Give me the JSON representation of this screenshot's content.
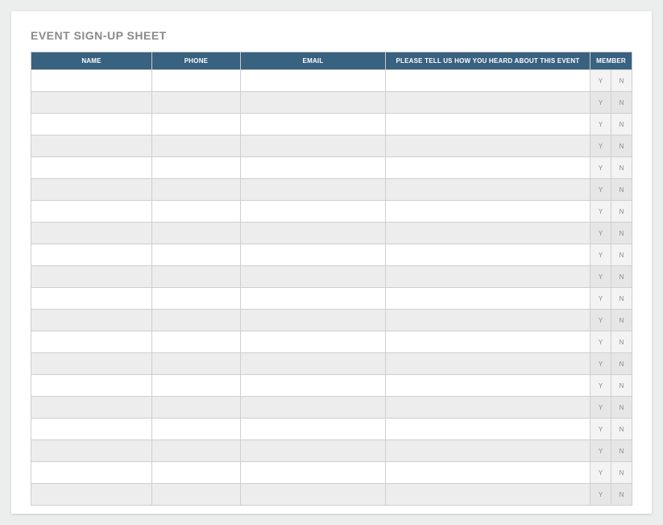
{
  "title": "EVENT SIGN-UP SHEET",
  "columns": {
    "name": "NAME",
    "phone": "PHONE",
    "email": "EMAIL",
    "heard": "PLEASE TELL US HOW YOU HEARD ABOUT THIS EVENT",
    "member": "MEMBER"
  },
  "yn": {
    "y": "Y",
    "n": "N"
  },
  "row_count": 20
}
